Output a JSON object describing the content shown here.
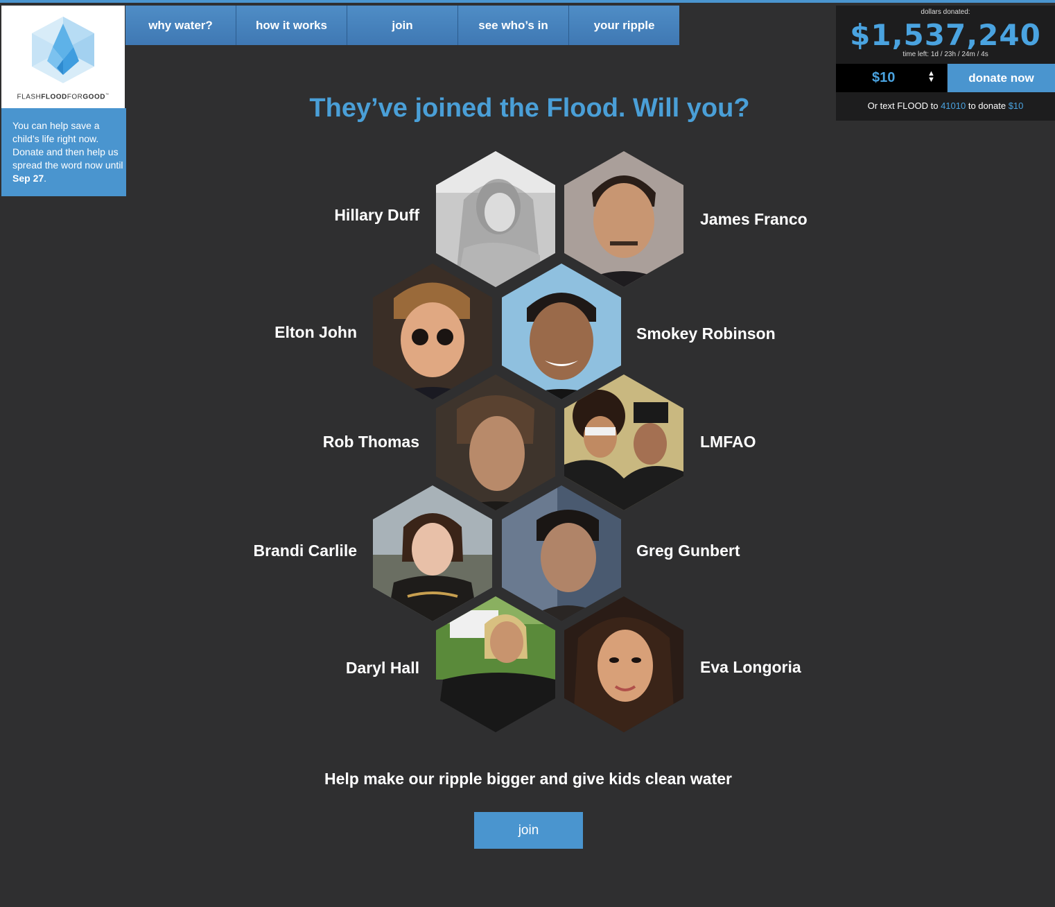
{
  "brand": {
    "logo_flash": "FLASH",
    "logo_flood": "FLOOD",
    "logo_for": "FOR",
    "logo_good": "GOOD",
    "tm": "™"
  },
  "intro": {
    "text": "You can help save a child’s life right now. Donate and then help us spread the word now until ",
    "date": "Sep 27",
    "end": "."
  },
  "nav": {
    "items": [
      "why water?",
      "how it works",
      "join",
      "see who’s in",
      "your ripple"
    ]
  },
  "donate": {
    "label": "dollars donated:",
    "amount": "$1,537,240",
    "time_left": "time left:  1d  /  23h  /  24m  /  4s",
    "selected_amount": "$10",
    "button": "donate now",
    "sms_prefix": "Or text FLOOD to ",
    "sms_number": "41010",
    "sms_mid": " to donate ",
    "sms_amount": "$10"
  },
  "headline": "They’ve joined the Flood. Will you?",
  "celebrities": [
    "Hillary Duff",
    "James Franco",
    "Elton John",
    "Smokey Robinson",
    "Rob Thomas",
    "LMFAO",
    "Brandi Carlile",
    "Greg Gunbert",
    "Daryl Hall",
    "Eva Longoria"
  ],
  "cta_text": "Help make our ripple bigger and give kids clean water",
  "cta_button": "join",
  "colors": {
    "background": "#2f2f30",
    "accent_blue": "#4a95cf",
    "headline_blue": "#4a9fd7",
    "panel_dark": "#1d1d1e"
  }
}
